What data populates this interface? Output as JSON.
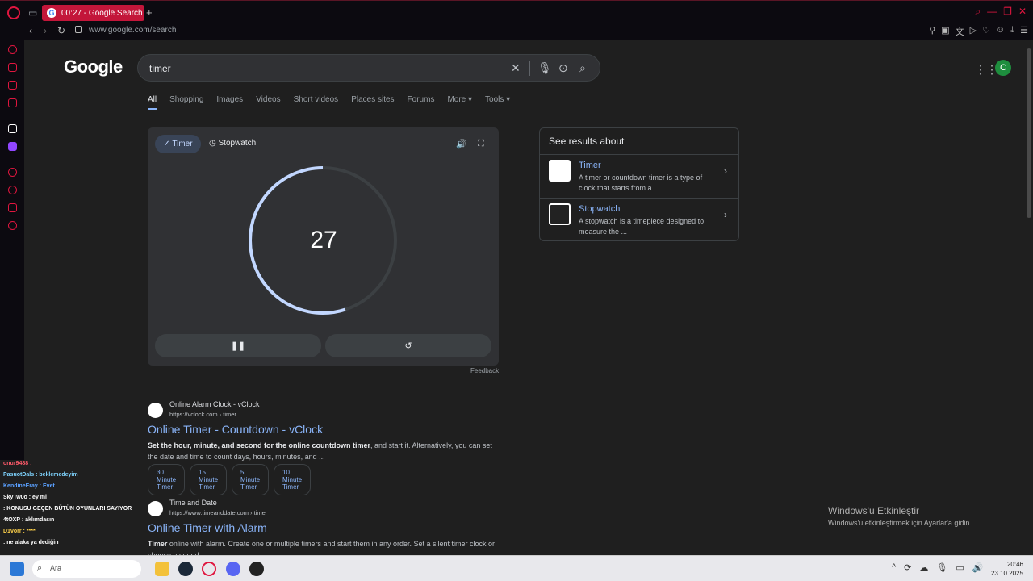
{
  "browser": {
    "tab_title": "00:27 - Google Search",
    "new_tab": "+",
    "url": "www.google.com/search"
  },
  "search": {
    "query": "timer",
    "tabs": [
      "All",
      "Shopping",
      "Images",
      "Videos",
      "Short videos",
      "Places sites",
      "Forums",
      "More ▾",
      "Tools ▾"
    ],
    "avatar_letter": "C"
  },
  "google_logo": "Google",
  "timer_widget": {
    "mode_timer": "✓ Timer",
    "mode_stopwatch": "Stopwatch",
    "value": "27",
    "progress": 0.45,
    "feedback": "Feedback"
  },
  "about": {
    "title": "See results about",
    "items": [
      {
        "name": "Timer",
        "desc": "A timer or countdown timer is a type of clock that starts from a ..."
      },
      {
        "name": "Stopwatch",
        "desc": "A stopwatch is a timepiece designed to measure the ..."
      }
    ]
  },
  "results": [
    {
      "site": "Online Alarm Clock - vClock",
      "url": "https://vclock.com › timer",
      "title": "Online Timer - Countdown - vClock",
      "snippet_bold": "Set the hour, minute, and second for the online countdown timer",
      "snippet_rest": ", and start it. Alternatively, you can set the date and time to count days, hours, minutes, and ...",
      "chips": [
        "30 Minute Timer",
        "15 Minute Timer",
        "5 Minute Timer",
        "10 Minute Timer"
      ]
    },
    {
      "site": "Time and Date",
      "url": "https://www.timeanddate.com › timer",
      "title": "Online Timer with Alarm",
      "snippet_bold": "Timer",
      "snippet_rest": " online with alarm. Create one or multiple timers and start them in any order. Set a silent timer clock or choose a sound."
    }
  ],
  "windows_activation": {
    "title": "Windows'u Etkinleştir",
    "subtitle": "Windows'u etkinleştirmek için Ayarlar'a gidin."
  },
  "chat_overlay": [
    {
      "text": "onur9488 :",
      "color": "#ff5a6a"
    },
    {
      "text": "PasuotDals : beklemedeyim",
      "color": "#7fd4ff"
    },
    {
      "text": "KendineEray : Evet",
      "color": "#5aa0ff"
    },
    {
      "text": "SkyTw0o : ey mi",
      "color": "#ffffff"
    },
    {
      "text": ": KONUSU GEÇEN BÜTÜN OYUNLARI SAYIYOR",
      "color": "#ffffff"
    },
    {
      "text": "4tOXP : aklımdasın",
      "color": "#ffffff"
    },
    {
      "text": "D1vorr : ****",
      "color": "#ffd24a"
    },
    {
      "text": ": ne alaka ya dediğin",
      "color": "#ffffff"
    }
  ],
  "taskbar": {
    "search_placeholder": "Ara",
    "time": "20:46",
    "date": "23.10.2025"
  }
}
